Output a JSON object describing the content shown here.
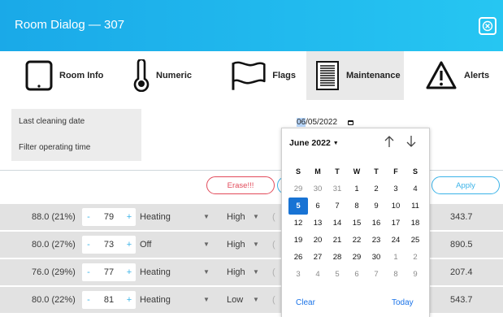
{
  "window": {
    "title": "Room Dialog — 307"
  },
  "tabs": [
    {
      "label": "Room Info",
      "icon": "tablet-icon"
    },
    {
      "label": "Numeric",
      "icon": "thermometer-icon"
    },
    {
      "label": "Flags",
      "icon": "flag-icon"
    },
    {
      "label": "Maintenance",
      "icon": "document-lines-icon",
      "active": true
    },
    {
      "label": "Alerts",
      "icon": "warning-triangle-icon"
    }
  ],
  "maintenance": {
    "last_cleaning_label": "Last cleaning date",
    "filter_time_label": "Filter operating time",
    "date_value": {
      "month": "06",
      "rest": "/05/2022"
    }
  },
  "actions": {
    "erase_label": "Erase!!!",
    "apply_label": "Apply"
  },
  "rows": [
    {
      "flow": "88.0 (21%)",
      "setpoint": "79",
      "mode": "Heating",
      "fan": "High",
      "value": "343.7",
      "partial": "("
    },
    {
      "flow": "80.0 (27%)",
      "setpoint": "73",
      "mode": "Off",
      "fan": "High",
      "value": "890.5",
      "partial": "("
    },
    {
      "flow": "76.0 (29%)",
      "setpoint": "77",
      "mode": "Heating",
      "fan": "High",
      "value": "207.4",
      "partial": "("
    },
    {
      "flow": "80.0 (22%)",
      "setpoint": "81",
      "mode": "Heating",
      "fan": "Low",
      "value": "543.7",
      "partial": "("
    }
  ],
  "stepper": {
    "minus": "-",
    "plus": "+"
  },
  "datepicker": {
    "month_label": "June 2022",
    "weekdays": [
      "S",
      "M",
      "T",
      "W",
      "T",
      "F",
      "S"
    ],
    "weeks": [
      [
        {
          "d": "29",
          "o": true
        },
        {
          "d": "30",
          "o": true
        },
        {
          "d": "31",
          "o": true
        },
        {
          "d": "1"
        },
        {
          "d": "2"
        },
        {
          "d": "3"
        },
        {
          "d": "4"
        }
      ],
      [
        {
          "d": "5",
          "t": true
        },
        {
          "d": "6"
        },
        {
          "d": "7"
        },
        {
          "d": "8"
        },
        {
          "d": "9"
        },
        {
          "d": "10"
        },
        {
          "d": "11"
        }
      ],
      [
        {
          "d": "12"
        },
        {
          "d": "13"
        },
        {
          "d": "14"
        },
        {
          "d": "15"
        },
        {
          "d": "16"
        },
        {
          "d": "17"
        },
        {
          "d": "18"
        }
      ],
      [
        {
          "d": "19"
        },
        {
          "d": "20"
        },
        {
          "d": "21"
        },
        {
          "d": "22"
        },
        {
          "d": "23"
        },
        {
          "d": "24"
        },
        {
          "d": "25"
        }
      ],
      [
        {
          "d": "26"
        },
        {
          "d": "27"
        },
        {
          "d": "28"
        },
        {
          "d": "29"
        },
        {
          "d": "30"
        },
        {
          "d": "1",
          "o": true
        },
        {
          "d": "2",
          "o": true
        }
      ],
      [
        {
          "d": "3",
          "o": true
        },
        {
          "d": "4",
          "o": true
        },
        {
          "d": "5",
          "o": true
        },
        {
          "d": "6",
          "o": true
        },
        {
          "d": "7",
          "o": true
        },
        {
          "d": "8",
          "o": true
        },
        {
          "d": "9",
          "o": true
        }
      ]
    ],
    "clear_label": "Clear",
    "today_label": "Today"
  },
  "colors": {
    "titlebar": "#1aa9e8",
    "accent": "#3ab3e8",
    "danger": "#e24a5a",
    "selected_day": "#1873d4"
  }
}
